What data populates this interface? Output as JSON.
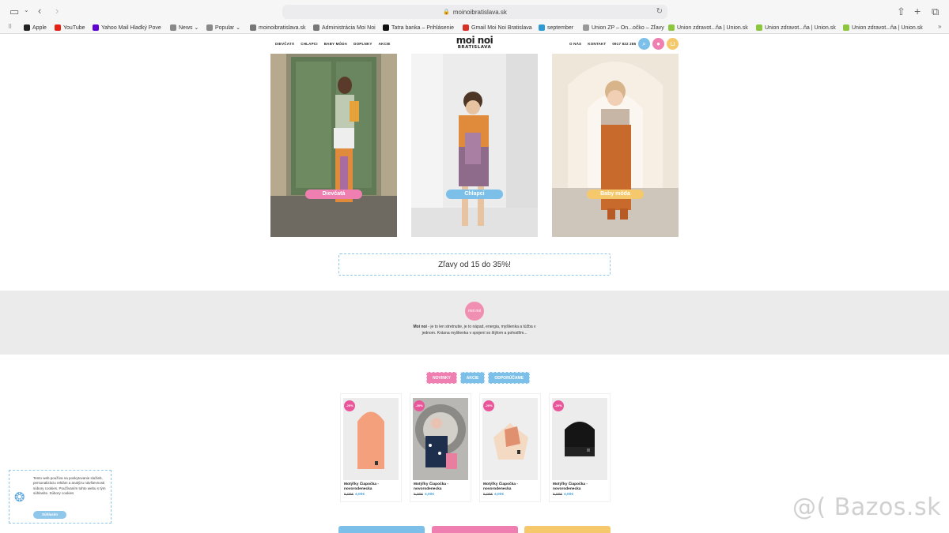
{
  "browser": {
    "url": "moinoibratislava.sk",
    "bookmarks": [
      {
        "label": "Apple",
        "color": "#222"
      },
      {
        "label": "YouTube",
        "color": "#e62117"
      },
      {
        "label": "Yahoo Mail Hladký Pove",
        "color": "#6001d2"
      },
      {
        "label": "News ⌄",
        "color": "#888"
      },
      {
        "label": "Popular ⌄",
        "color": "#888"
      },
      {
        "label": "moinoibratislava.sk",
        "color": "#777"
      },
      {
        "label": "Administrácia Moi Noi",
        "color": "#777"
      },
      {
        "label": "Tatra banka – Prihlásenie",
        "color": "#111"
      },
      {
        "label": "Gmail Moi Noi Bratislava",
        "color": "#d93025"
      },
      {
        "label": "september",
        "color": "#2f9bd4"
      },
      {
        "label": "Union ZP – On...očko – Zľavy",
        "color": "#999"
      },
      {
        "label": "Union zdravot...ňa | Union.sk",
        "color": "#8dc63f"
      },
      {
        "label": "Union zdravot...ňa | Union.sk",
        "color": "#8dc63f"
      },
      {
        "label": "Union zdravot...ňa | Union.sk",
        "color": "#8dc63f"
      }
    ]
  },
  "header": {
    "nav_left": [
      "DIEVČATÁ",
      "CHLAPCI",
      "BABY MÓDA",
      "DOPLNKY",
      "AKCIE"
    ],
    "nav_right": [
      "O NÁS",
      "KONTAKT",
      "0917 822 285"
    ],
    "logo_line1": "moi noi",
    "logo_line2": "BRATISLAVA"
  },
  "hero": [
    {
      "label": "Dievčatá",
      "color": "#ee7fb0"
    },
    {
      "label": "Chlapci",
      "color": "#7cc0ea"
    },
    {
      "label": "Baby móda",
      "color": "#f5c86b"
    }
  ],
  "discount_text": "Zľavy od 15 do 35%!",
  "about": {
    "badge": "moi noi",
    "brand": "Moi noi",
    "text": " - je to len stretnutie, je to nápad, energia, myšlienka a túžba v jednom. Krásna myšlienka v spojení so štýlom a pohodlím..."
  },
  "tabs": [
    {
      "label": "NOVINKY",
      "color": "#ee7fb0"
    },
    {
      "label": "AKCIE",
      "color": "#7cc0ea"
    },
    {
      "label": "ODPORÚČAME",
      "color": "#7cc0ea"
    }
  ],
  "products": [
    {
      "badge": "-20%",
      "name": "Motýľky Čiapočka - novorodenecka",
      "old": "5,00€",
      "new": "4,00€"
    },
    {
      "badge": "-20%",
      "name": "Motýľky Čiapočka - novorodenecka",
      "old": "5,00€",
      "new": "4,00€"
    },
    {
      "badge": "-20%",
      "name": "Motýľky Čiapočka - novorodenecka",
      "old": "5,00€",
      "new": "4,00€"
    },
    {
      "badge": "-20%",
      "name": "Motýľky Čiapočka - novorodenecka",
      "old": "5,00€",
      "new": "4,00€"
    }
  ],
  "cookie": {
    "text": "Tento web používa na poskytovanie služieb, personalizáciu reklám a analýzu návštevnosti súbory cookies. Používaním tohto webu s tým súhlasíte. Súbory cookies",
    "button": "Súhlasím"
  },
  "watermark": "@( Bazos.sk",
  "colors": {
    "pink": "#ee7fb0",
    "blue": "#7cc0ea",
    "yellow": "#f5c86b"
  }
}
